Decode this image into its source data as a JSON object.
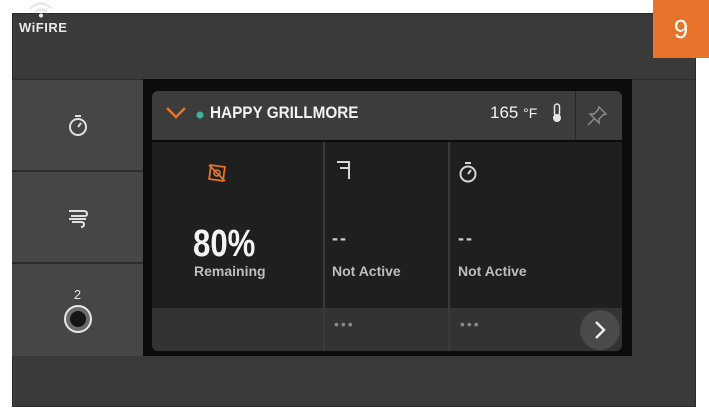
{
  "header": {
    "brand": "WiFIRE",
    "step_badge": "9"
  },
  "sidebar": {
    "items": [
      {
        "icon": "timer-icon"
      },
      {
        "icon": "smoke-icon"
      },
      {
        "icon": "meat-probe-icon",
        "number": "2"
      }
    ]
  },
  "grill_panel": {
    "name": "HAPPY GRILLMORE",
    "status_dot_color": "#3fb39a",
    "temperature": "165",
    "temperature_unit": "°F",
    "accent_color": "#e8742c",
    "stats": [
      {
        "icon": "pellet-sensor-icon",
        "value": "80%",
        "label": "Remaining",
        "more": ""
      },
      {
        "icon": "probe-icon",
        "value": "--",
        "label": "Not Active",
        "more": "•••"
      },
      {
        "icon": "timer-icon",
        "value": "--",
        "label": "Not Active",
        "more": "•••"
      }
    ]
  }
}
